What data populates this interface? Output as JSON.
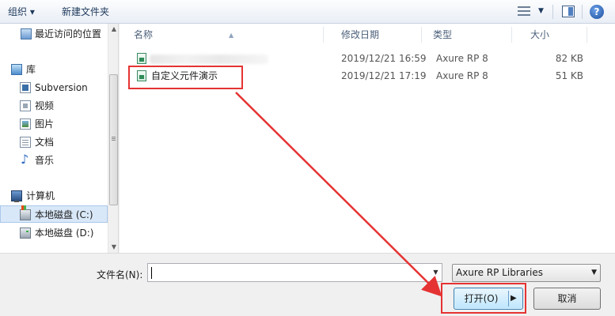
{
  "toolbar": {
    "organize_label": "组织 ▾",
    "new_folder_label": "新建文件夹",
    "help_glyph": "?"
  },
  "nav": {
    "items": [
      {
        "label": "最近访问的位置",
        "icon": "recent-places-icon"
      },
      {
        "label": "库",
        "icon": "library-icon"
      },
      {
        "label": "Subversion",
        "icon": "subversion-icon"
      },
      {
        "label": "视频",
        "icon": "video-icon"
      },
      {
        "label": "图片",
        "icon": "pictures-icon"
      },
      {
        "label": "文档",
        "icon": "documents-icon"
      },
      {
        "label": "音乐",
        "icon": "music-icon"
      },
      {
        "label": "计算机",
        "icon": "computer-icon"
      },
      {
        "label": "本地磁盘 (C:)",
        "icon": "drive-c-icon"
      },
      {
        "label": "本地磁盘 (D:)",
        "icon": "drive-d-icon"
      }
    ],
    "selected_index": 8
  },
  "filelist": {
    "columns": [
      "名称",
      "修改日期",
      "类型",
      "大小"
    ],
    "rows": [
      {
        "name": "",
        "modified": "2019/12/21 16:59",
        "type": "Axure RP 8",
        "size": "82 KB",
        "name_obscured": true
      },
      {
        "name": "自定义元件演示",
        "modified": "2019/12/21 17:19",
        "type": "Axure RP 8",
        "size": "51 KB",
        "name_obscured": false
      }
    ]
  },
  "bottom": {
    "filename_label": "文件名(N):",
    "filename_value": "",
    "filter_value": "Axure RP Libraries",
    "open_label": "打开(O)",
    "cancel_label": "取消"
  },
  "colors": {
    "highlight": "#e53333",
    "toolbar_text": "#1e395b",
    "selection": "#d9e8f8"
  }
}
